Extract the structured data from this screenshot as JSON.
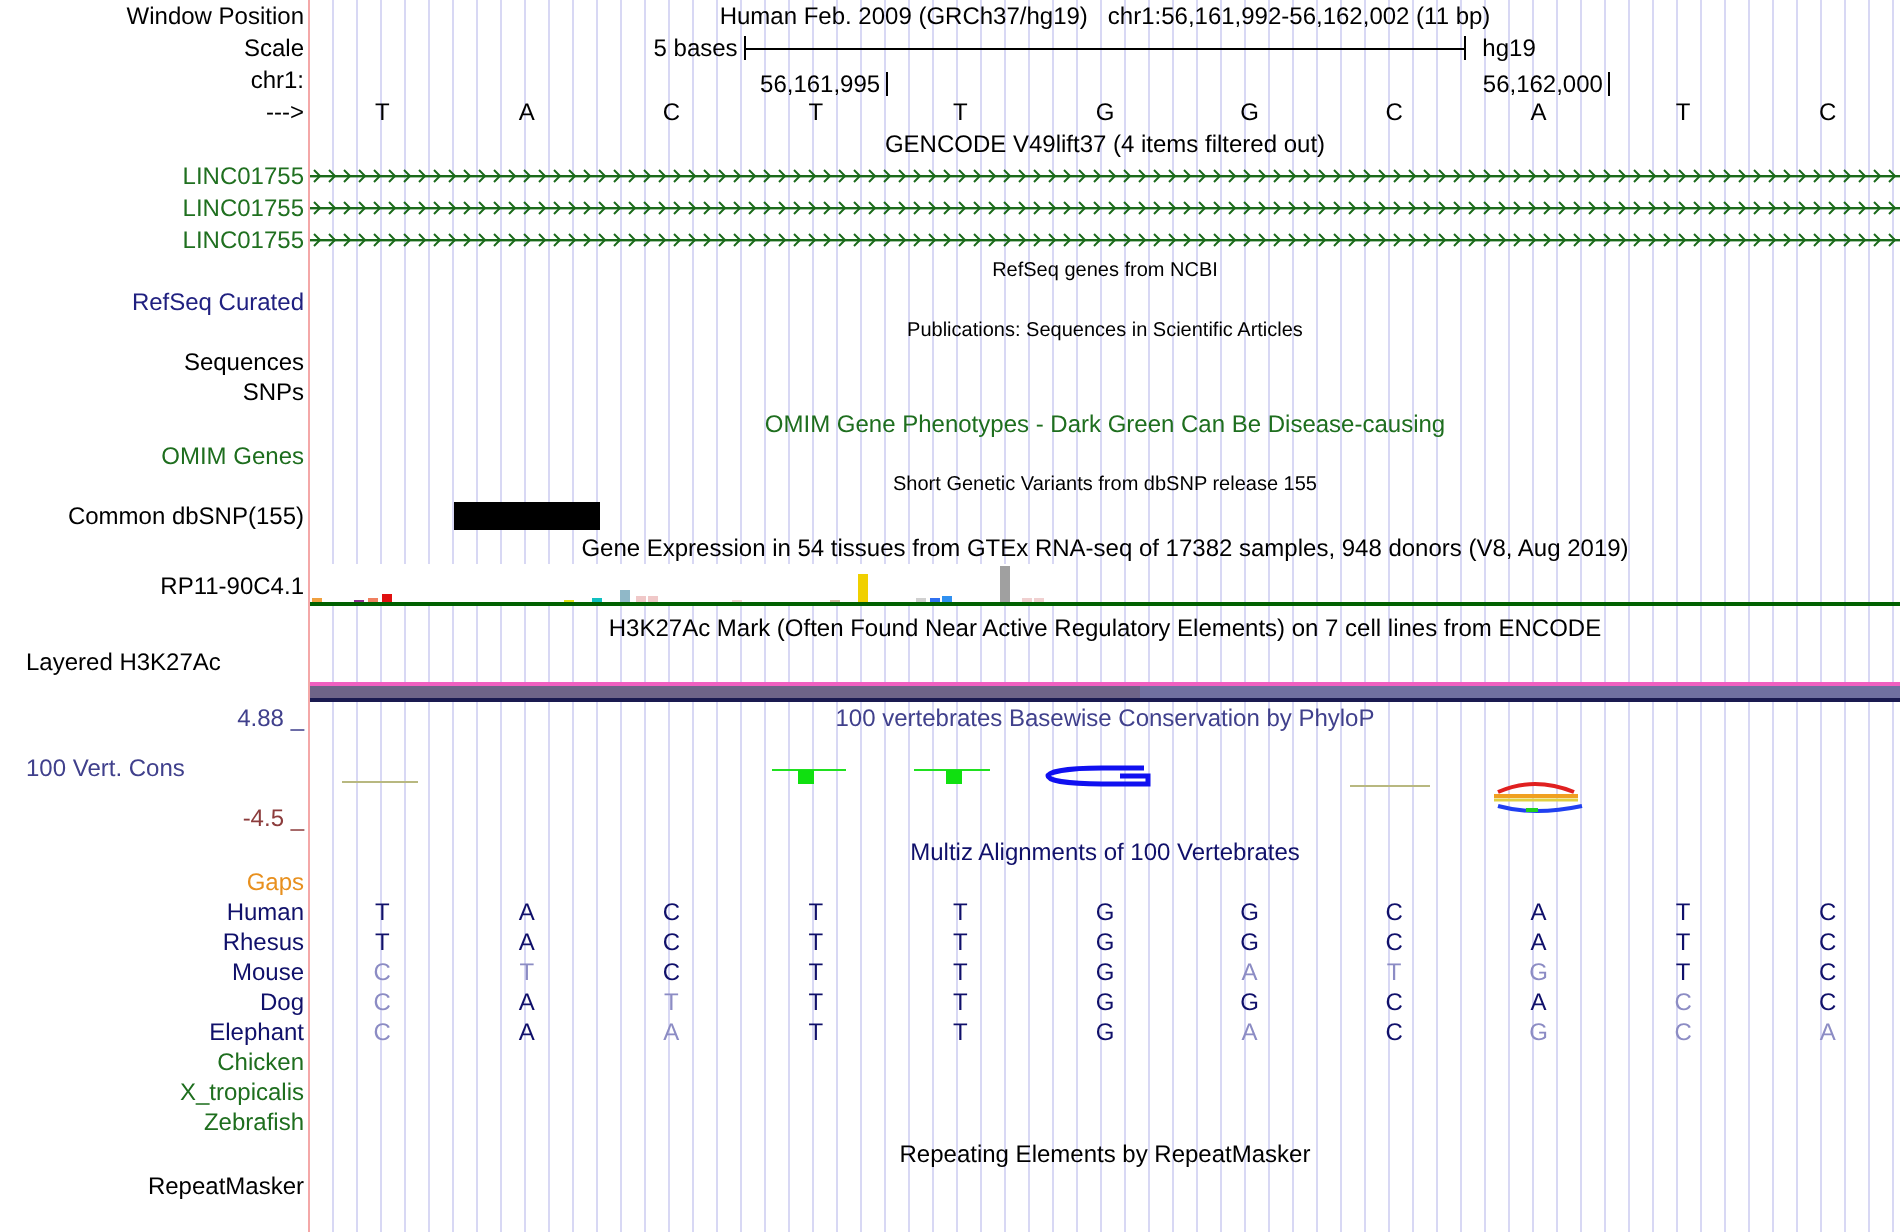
{
  "position": {
    "label": "Window Position",
    "assembly": "Human Feb. 2009 (GRCh37/hg19)",
    "range": "chr1:56,161,992-56,162,002 (11 bp)"
  },
  "scale": {
    "label": "Scale",
    "span": "5 bases",
    "assembly": "hg19"
  },
  "coordinates": {
    "label": "chr1:",
    "ticks": [
      "56,161,995",
      "56,162,000"
    ]
  },
  "strand": {
    "label": "--->",
    "bases": [
      "T",
      "A",
      "C",
      "T",
      "T",
      "G",
      "G",
      "C",
      "A",
      "T",
      "C"
    ]
  },
  "tracks": [
    {
      "kind": "genes",
      "title": {
        "text": "GENCODE V49lift37 (4 items filtered out)",
        "color": "#000000"
      },
      "rows": [
        {
          "label": "LINC01755",
          "color": "#207020"
        },
        {
          "label": "LINC01755",
          "color": "#207020"
        },
        {
          "label": "LINC01755",
          "color": "#207020"
        }
      ]
    },
    {
      "kind": "compact",
      "title": {
        "text": "RefSeq genes from NCBI",
        "color": "#000000"
      },
      "rows": [
        {
          "label": "RefSeq Curated",
          "color": "#202080"
        }
      ]
    },
    {
      "kind": "compact",
      "title": {
        "text": "Publications: Sequences in Scientific Articles",
        "color": "#000000"
      },
      "rows": [
        {
          "label": "Sequences",
          "color": "#000000"
        },
        {
          "label": "SNPs",
          "color": "#000000"
        }
      ]
    },
    {
      "kind": "plain",
      "title": {
        "text": "OMIM Gene Phenotypes - Dark Green Can Be Disease-causing",
        "color": "#1e6e1e"
      },
      "rows": [
        {
          "label": "OMIM Genes",
          "color": "#1e6e1e"
        }
      ]
    },
    {
      "kind": "variants",
      "title": {
        "text": "Short Genetic Variants from dbSNP release 155",
        "color": "#000000"
      },
      "rows": [
        {
          "label": "Common dbSNP(155)",
          "color": "#000000"
        }
      ]
    },
    {
      "kind": "expression",
      "title": {
        "text": "Gene Expression in 54 tissues from GTEx RNA-seq of 17382 samples, 948 donors (V8, Aug 2019)",
        "color": "#000000"
      },
      "rows": [
        {
          "label": "RP11-90C4.1",
          "color": "#000000"
        }
      ]
    },
    {
      "kind": "layered",
      "title": {
        "text": "H3K27Ac Mark (Often Found Near Active Regulatory Elements) on 7 cell lines from ENCODE",
        "color": "#000000"
      },
      "rows": [
        {
          "label": "Layered H3K27Ac",
          "color": "#000000"
        }
      ]
    },
    {
      "kind": "conservation",
      "title": {
        "text": "100 vertebrates Basewise Conservation by PhyloP",
        "color": "#40408c"
      },
      "rows": [
        {
          "label": "100 Vert. Cons",
          "color": "#40408c"
        }
      ],
      "max": "4.88 _",
      "min": "-4.5 _"
    },
    {
      "kind": "alignment",
      "title": {
        "text": "Multiz Alignments of 100 Vertebrates",
        "color": "#10106a"
      },
      "gaps": {
        "label": "Gaps",
        "color": "#e8901e"
      },
      "species": [
        {
          "label": "Human",
          "color": "#10106a",
          "bases": [
            {
              "base": "T",
              "match": true
            },
            {
              "base": "A",
              "match": true
            },
            {
              "base": "C",
              "match": true
            },
            {
              "base": "T",
              "match": true
            },
            {
              "base": "T",
              "match": true
            },
            {
              "base": "G",
              "match": true
            },
            {
              "base": "G",
              "match": true
            },
            {
              "base": "C",
              "match": true
            },
            {
              "base": "A",
              "match": true
            },
            {
              "base": "T",
              "match": true
            },
            {
              "base": "C",
              "match": true
            }
          ]
        },
        {
          "label": "Rhesus",
          "color": "#10106a",
          "bases": [
            {
              "base": "T",
              "match": true
            },
            {
              "base": "A",
              "match": true
            },
            {
              "base": "C",
              "match": true
            },
            {
              "base": "T",
              "match": true
            },
            {
              "base": "T",
              "match": true
            },
            {
              "base": "G",
              "match": true
            },
            {
              "base": "G",
              "match": true
            },
            {
              "base": "C",
              "match": true
            },
            {
              "base": "A",
              "match": true
            },
            {
              "base": "T",
              "match": true
            },
            {
              "base": "C",
              "match": true
            }
          ]
        },
        {
          "label": "Mouse",
          "color": "#10106a",
          "bases": [
            {
              "base": "C",
              "match": false
            },
            {
              "base": "T",
              "match": false
            },
            {
              "base": "C",
              "match": true
            },
            {
              "base": "T",
              "match": true
            },
            {
              "base": "T",
              "match": true
            },
            {
              "base": "G",
              "match": true
            },
            {
              "base": "A",
              "match": false
            },
            {
              "base": "T",
              "match": false
            },
            {
              "base": "G",
              "match": false
            },
            {
              "base": "T",
              "match": true
            },
            {
              "base": "C",
              "match": true
            }
          ]
        },
        {
          "label": "Dog",
          "color": "#10106a",
          "bases": [
            {
              "base": "C",
              "match": false
            },
            {
              "base": "A",
              "match": true
            },
            {
              "base": "T",
              "match": false
            },
            {
              "base": "T",
              "match": true
            },
            {
              "base": "T",
              "match": true
            },
            {
              "base": "G",
              "match": true
            },
            {
              "base": "G",
              "match": true
            },
            {
              "base": "C",
              "match": true
            },
            {
              "base": "A",
              "match": true
            },
            {
              "base": "C",
              "match": false
            },
            {
              "base": "C",
              "match": true
            }
          ]
        },
        {
          "label": "Elephant",
          "color": "#10106a",
          "bases": [
            {
              "base": "C",
              "match": false
            },
            {
              "base": "A",
              "match": true
            },
            {
              "base": "A",
              "match": false
            },
            {
              "base": "T",
              "match": true
            },
            {
              "base": "T",
              "match": true
            },
            {
              "base": "G",
              "match": true
            },
            {
              "base": "A",
              "match": false
            },
            {
              "base": "C",
              "match": true
            },
            {
              "base": "G",
              "match": false
            },
            {
              "base": "C",
              "match": false
            },
            {
              "base": "A",
              "match": false
            }
          ]
        },
        {
          "label": "Chicken",
          "color": "#1e6e1e"
        },
        {
          "label": "X_tropicalis",
          "color": "#1e6e1e"
        },
        {
          "label": "Zebrafish",
          "color": "#1e6e1e"
        }
      ]
    },
    {
      "kind": "plain",
      "title": {
        "text": "Repeating Elements by RepeatMasker",
        "color": "#000000"
      },
      "rows": [
        {
          "label": "RepeatMasker",
          "color": "#000000"
        }
      ]
    }
  ]
}
